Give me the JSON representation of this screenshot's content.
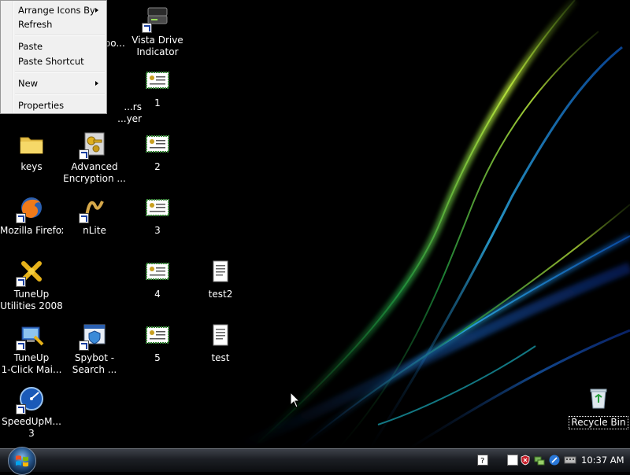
{
  "context_menu": {
    "items": [
      {
        "label": "Arrange Icons By",
        "submenu": true,
        "accel": "I"
      },
      {
        "label": "Refresh",
        "submenu": false,
        "accel": "e"
      },
      {
        "label": "Paste",
        "submenu": false,
        "accel": "P"
      },
      {
        "label": "Paste Shortcut",
        "submenu": false,
        "accel": "S"
      },
      {
        "label": "New",
        "submenu": true,
        "accel": "w"
      },
      {
        "label": "Properties",
        "submenu": false,
        "accel": "r"
      }
    ]
  },
  "desktop_icons": {
    "partial_col2_row1": "...po...",
    "partial_col2_row2_line1": "...rs",
    "partial_col2_row2_line2": "...yer",
    "vista_drive": {
      "line1": "Vista Drive",
      "line2": "Indicator",
      "icon": "drive-icon"
    },
    "cert1": {
      "line1": "1",
      "icon": "certificate-icon"
    },
    "keys": {
      "line1": "keys",
      "icon": "folder-icon"
    },
    "aes": {
      "line1": "Advanced",
      "line2": "Encryption ...",
      "icon": "keys-app-icon"
    },
    "cert2": {
      "line1": "2",
      "icon": "certificate-icon"
    },
    "firefox": {
      "line1": "Mozilla Firefox",
      "icon": "firefox-icon"
    },
    "nlite": {
      "line1": "nLite",
      "icon": "nlite-icon"
    },
    "cert3": {
      "line1": "3",
      "icon": "certificate-icon"
    },
    "tuneup2008": {
      "line1": "TuneUp",
      "line2": "Utilities 2008",
      "icon": "tuneup-icon"
    },
    "cert4": {
      "line1": "4",
      "icon": "certificate-icon"
    },
    "test2": {
      "line1": "test2",
      "icon": "text-document-icon"
    },
    "tuneup1click": {
      "line1": "TuneUp",
      "line2": "1-Click Mai...",
      "icon": "tuneup-maintenance-icon"
    },
    "spybot": {
      "line1": "Spybot -",
      "line2": "Search ...",
      "icon": "spybot-icon"
    },
    "cert5": {
      "line1": "5",
      "icon": "certificate-icon"
    },
    "test": {
      "line1": "test",
      "icon": "text-document-icon"
    },
    "speedup": {
      "line1": "SpeedUpM...",
      "line2": "3",
      "icon": "speedometer-icon"
    },
    "recycle": {
      "line1": "Recycle Bin",
      "icon": "recycle-bin-icon"
    }
  },
  "taskbar": {
    "start_icon": "windows-logo-icon",
    "tray": [
      "help-icon",
      "window-icon",
      "security-shield-icon",
      "network-icon",
      "pen-icon",
      "keyboard-icon"
    ],
    "clock": "10:37 AM"
  }
}
